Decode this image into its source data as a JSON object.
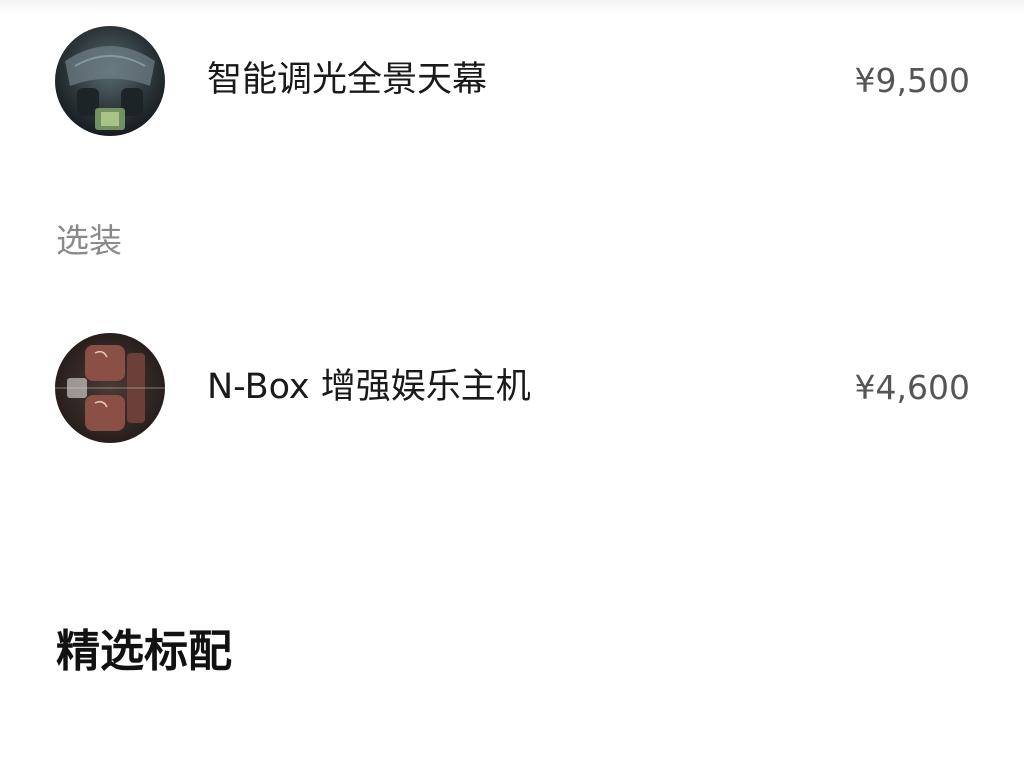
{
  "items": [
    {
      "name": "智能调光全景天幕",
      "price": "¥9,500",
      "thumbnail_icon": "panoramic-sunroof-photo"
    },
    {
      "name": "N-Box 增强娱乐主机",
      "price": "¥4,600",
      "thumbnail_icon": "rear-seats-entertainment-photo"
    }
  ],
  "optional_section": {
    "label": "选装"
  },
  "featured_section": {
    "heading": "精选标配"
  },
  "colors": {
    "text_primary": "#1a1a1a",
    "text_price": "#555555",
    "text_secondary": "#8a8a8a",
    "background": "#ffffff"
  }
}
